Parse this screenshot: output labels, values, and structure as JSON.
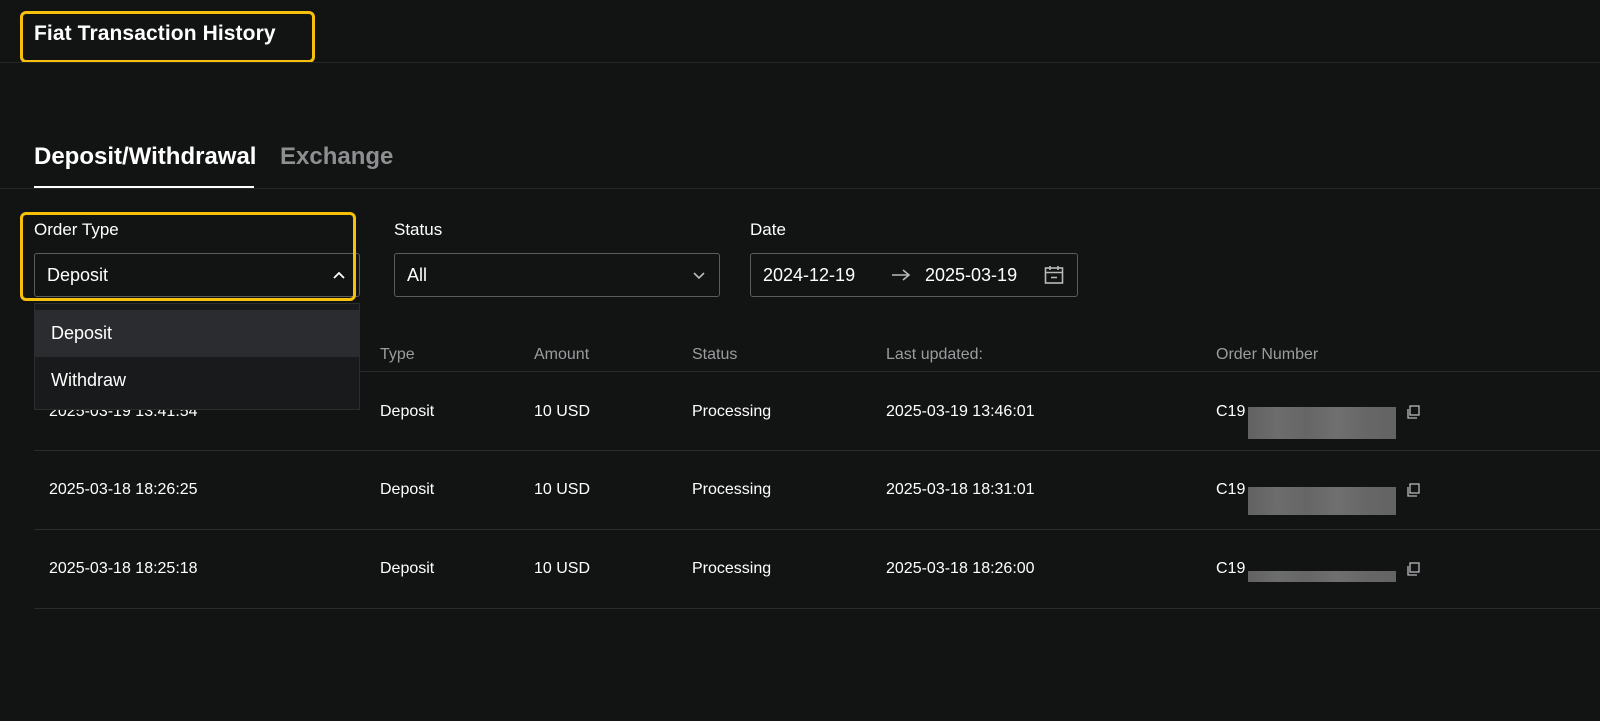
{
  "page": {
    "title": "Fiat Transaction History"
  },
  "tabs": [
    {
      "label": "Deposit/Withdrawal",
      "active": true
    },
    {
      "label": "Exchange",
      "active": false
    }
  ],
  "filters": {
    "order_type": {
      "label": "Order Type",
      "value": "Deposit",
      "options": [
        "Deposit",
        "Withdraw"
      ]
    },
    "status": {
      "label": "Status",
      "value": "All"
    },
    "date": {
      "label": "Date",
      "start": "2024-12-19",
      "end": "2025-03-19"
    }
  },
  "table": {
    "columns": [
      "Type",
      "Amount",
      "Status",
      "Last updated:",
      "Order Number"
    ],
    "rows": [
      {
        "created": "2025-03-19 13:41:54",
        "type": "Deposit",
        "amount": "10 USD",
        "status": "Processing",
        "updated": "2025-03-19 13:46:01",
        "order_prefix": "C19"
      },
      {
        "created": "2025-03-18 18:26:25",
        "type": "Deposit",
        "amount": "10 USD",
        "status": "Processing",
        "updated": "2025-03-18 18:31:01",
        "order_prefix": "C19"
      },
      {
        "created": "2025-03-18 18:25:18",
        "type": "Deposit",
        "amount": "10 USD",
        "status": "Processing",
        "updated": "2025-03-18 18:26:00",
        "order_prefix": "C19"
      }
    ]
  },
  "colors": {
    "background": "#121313",
    "highlight": "#f7c10b",
    "text_muted": "#9a9c9e"
  },
  "icons": [
    "chevron-up-icon",
    "chevron-down-icon",
    "arrow-right-icon",
    "calendar-icon",
    "copy-icon"
  ]
}
